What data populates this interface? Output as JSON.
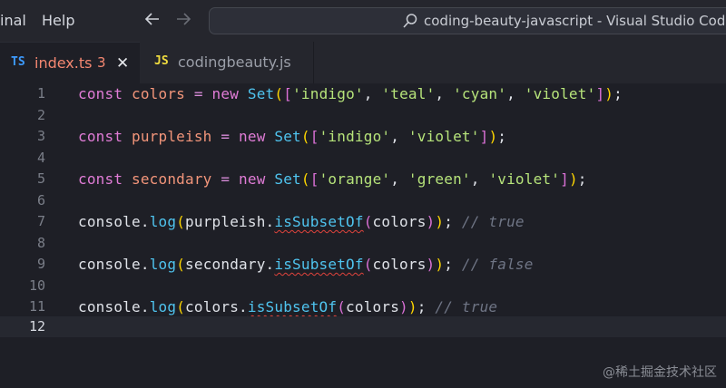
{
  "menu": {
    "items": [
      "inal",
      "Help"
    ]
  },
  "nav": {
    "back_icon": "arrow-left-icon",
    "forward_icon": "arrow-right-icon"
  },
  "command_center": {
    "text": "coding-beauty-javascript - Visual Studio Code"
  },
  "tabs": [
    {
      "icon": "TS",
      "label": "index.ts",
      "problems": "3",
      "close": "✕"
    },
    {
      "icon": "JS",
      "label": "codingbeauty.js"
    }
  ],
  "editor": {
    "current_line": "12",
    "line_numbers": [
      "1",
      "2",
      "3",
      "4",
      "5",
      "6",
      "7",
      "8",
      "9",
      "10",
      "11",
      "12"
    ],
    "lines": {
      "l1": {
        "k": "const",
        "v": "colors",
        "eq": "=",
        "new": "new",
        "cls": "Set",
        "b1o": "(",
        "b2o": "[",
        "s1": "'indigo'",
        "c1": ", ",
        "s2": "'teal'",
        "c2": ", ",
        "s3": "'cyan'",
        "c3": ", ",
        "s4": "'violet'",
        "b2c": "]",
        "b1c": ")",
        "semi": ";"
      },
      "l3": {
        "k": "const",
        "v": "purpleish",
        "eq": "=",
        "new": "new",
        "cls": "Set",
        "b1o": "(",
        "b2o": "[",
        "s1": "'indigo'",
        "c1": ", ",
        "s2": "'violet'",
        "b2c": "]",
        "b1c": ")",
        "semi": ";"
      },
      "l5": {
        "k": "const",
        "v": "secondary",
        "eq": "=",
        "new": "new",
        "cls": "Set",
        "b1o": "(",
        "b2o": "[",
        "s1": "'orange'",
        "c1": ", ",
        "s2": "'green'",
        "c2": ", ",
        "s3": "'violet'",
        "b2c": "]",
        "b1c": ")",
        "semi": ";"
      },
      "l7": {
        "obj": "console",
        "dot": ".",
        "fn": "log",
        "p1": "(",
        "arg": "purpleish",
        "dot2": ".",
        "m": "isSubsetOf",
        "p2": "(",
        "a2": "colors",
        "p2c": ")",
        "p1c": ")",
        "semi": ";",
        "cmt": "// true"
      },
      "l9": {
        "obj": "console",
        "dot": ".",
        "fn": "log",
        "p1": "(",
        "arg": "secondary",
        "dot2": ".",
        "m": "isSubsetOf",
        "p2": "(",
        "a2": "colors",
        "p2c": ")",
        "p1c": ")",
        "semi": ";",
        "cmt": "// false"
      },
      "l11": {
        "obj": "console",
        "dot": ".",
        "fn": "log",
        "p1": "(",
        "arg": "colors",
        "dot2": ".",
        "m": "isSubsetOf",
        "p2": "(",
        "a2": "colors",
        "p2c": ")",
        "p1c": ")",
        "semi": ";",
        "cmt": "// true"
      }
    }
  },
  "watermark": {
    "text": "@稀土掘金技术社区"
  },
  "colors": {
    "ts_badge": "#3d9bff",
    "js_badge": "#f1dd3f",
    "error_text": "#f48771"
  }
}
